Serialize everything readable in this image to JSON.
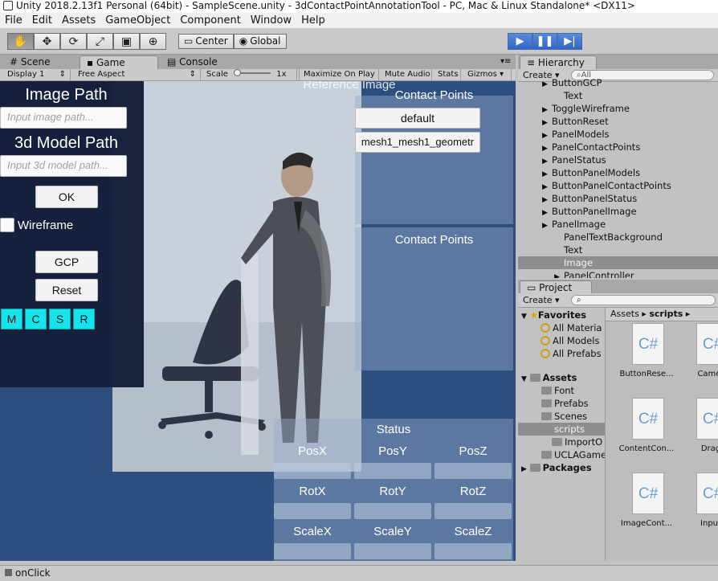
{
  "window": {
    "title": "Unity 2018.2.13f1 Personal (64bit) - SampleScene.unity - 3dContactPointAnnotationTool - PC, Mac & Linux Standalone* <DX11>"
  },
  "menu": [
    "File",
    "Edit",
    "Assets",
    "GameObject",
    "Component",
    "Window",
    "Help"
  ],
  "toolbar": {
    "tools": [
      {
        "icon": "hand-icon",
        "glyph": "✋"
      },
      {
        "icon": "move-icon",
        "glyph": "✥"
      },
      {
        "icon": "rotate-icon",
        "glyph": "⟳"
      },
      {
        "icon": "scale-icon",
        "glyph": "⤢"
      },
      {
        "icon": "rect-icon",
        "glyph": "▣"
      },
      {
        "icon": "transform-icon",
        "glyph": "⊕"
      }
    ],
    "pivot": "Center",
    "space": "Global",
    "play": {
      "glyph": "▶"
    },
    "pause": {
      "glyph": "❚❚"
    },
    "step": {
      "glyph": "▶|"
    }
  },
  "tabs": {
    "scene": "Scene",
    "game": "Game",
    "console": "Console"
  },
  "game_toolbar": {
    "display": "Display 1",
    "aspect": "Free Aspect",
    "scale_label": "Scale",
    "scale_value": "1x",
    "maximize": "Maximize On Play",
    "mute": "Mute Audio",
    "stats": "Stats",
    "gizmos": "Gizmos"
  },
  "game": {
    "image_path_label": "Image Path",
    "image_path_placeholder": "Input image path...",
    "model_path_label": "3d Model Path",
    "model_path_placeholder": "Input 3d model path...",
    "ok": "OK",
    "wireframe": "Wireframe",
    "wireframe_checked": false,
    "gcp": "GCP",
    "reset": "Reset",
    "shortcut_buttons": [
      "M",
      "C",
      "S",
      "R"
    ],
    "reference_image": "Reference Image",
    "contact_points_1": "Contact Points",
    "contact_points_2": "Contact Points",
    "contact_default": "default",
    "contact_mesh": "mesh1_mesh1_geometr",
    "status_title": "Status",
    "status_labels": [
      [
        "PosX",
        "PosY",
        "PosZ"
      ],
      [
        "RotX",
        "RotY",
        "RotZ"
      ],
      [
        "ScaleX",
        "ScaleY",
        "ScaleZ"
      ]
    ]
  },
  "hierarchy": {
    "tab": "Hierarchy",
    "create": "Create",
    "search_placeholder": "All",
    "items": [
      {
        "label": "ButtonGCP",
        "indent": 2,
        "arrow": true,
        "selected": false
      },
      {
        "label": "Text",
        "indent": 3,
        "arrow": false,
        "selected": false
      },
      {
        "label": "ToggleWireframe",
        "indent": 2,
        "arrow": true,
        "selected": false
      },
      {
        "label": "ButtonReset",
        "indent": 2,
        "arrow": true,
        "selected": false
      },
      {
        "label": "PanelModels",
        "indent": 2,
        "arrow": true,
        "selected": false
      },
      {
        "label": "PanelContactPoints",
        "indent": 2,
        "arrow": true,
        "selected": false
      },
      {
        "label": "PanelStatus",
        "indent": 2,
        "arrow": true,
        "selected": false
      },
      {
        "label": "ButtonPanelModels",
        "indent": 2,
        "arrow": true,
        "selected": false
      },
      {
        "label": "ButtonPanelContactPoints",
        "indent": 2,
        "arrow": true,
        "selected": false
      },
      {
        "label": "ButtonPanelStatus",
        "indent": 2,
        "arrow": true,
        "selected": false
      },
      {
        "label": "ButtonPanelImage",
        "indent": 2,
        "arrow": true,
        "selected": false
      },
      {
        "label": "PanelImage",
        "indent": 2,
        "arrow": true,
        "selected": false
      },
      {
        "label": "PanelTextBackground",
        "indent": 3,
        "arrow": false,
        "selected": false
      },
      {
        "label": "Text",
        "indent": 3,
        "arrow": false,
        "selected": false
      },
      {
        "label": "Image",
        "indent": 3,
        "arrow": false,
        "selected": true
      },
      {
        "label": "PanelController",
        "indent": 3,
        "arrow": true,
        "selected": false
      }
    ]
  },
  "project": {
    "tab": "Project",
    "create": "Create",
    "breadcrumb_root": "Assets",
    "breadcrumb_current": "scripts",
    "favorites": "Favorites",
    "favorite_items": [
      "All Materia",
      "All Models",
      "All Prefabs"
    ],
    "assets": "Assets",
    "asset_folders": [
      {
        "label": "Font",
        "indent": 1,
        "selected": false
      },
      {
        "label": "Prefabs",
        "indent": 1,
        "selected": false
      },
      {
        "label": "Scenes",
        "indent": 1,
        "selected": false
      },
      {
        "label": "scripts",
        "indent": 1,
        "selected": true
      },
      {
        "label": "ImportO",
        "indent": 2,
        "selected": false
      },
      {
        "label": "UCLAGame",
        "indent": 1,
        "selected": false
      }
    ],
    "packages": "Packages",
    "files": [
      {
        "label": "ButtonRese...",
        "glyph": "C#"
      },
      {
        "label": "Camer",
        "glyph": "C#"
      },
      {
        "label": "ContentCon...",
        "glyph": "C#"
      },
      {
        "label": "Drag",
        "glyph": "C#"
      },
      {
        "label": "ImageCont...",
        "glyph": "C#"
      },
      {
        "label": "Input",
        "glyph": "C#"
      }
    ]
  },
  "statusbar": {
    "message": "onClick"
  }
}
